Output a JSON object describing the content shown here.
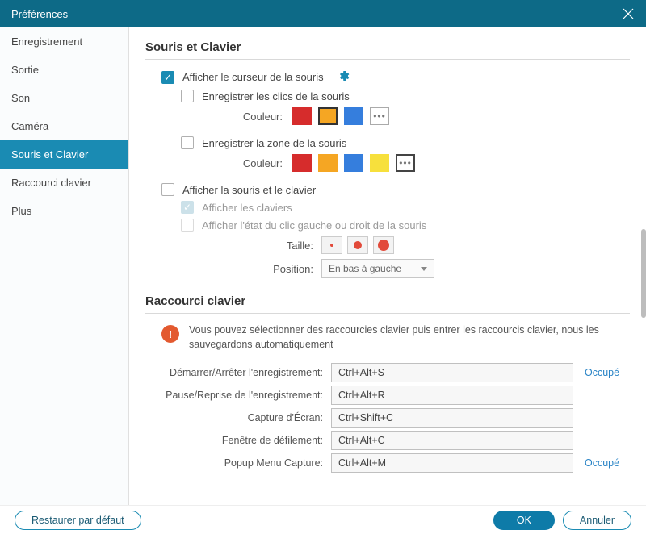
{
  "titlebar": {
    "title": "Préférences"
  },
  "sidebar": {
    "items": [
      {
        "label": "Enregistrement"
      },
      {
        "label": "Sortie"
      },
      {
        "label": "Son"
      },
      {
        "label": "Caméra"
      },
      {
        "label": "Souris et Clavier"
      },
      {
        "label": "Raccourci clavier"
      },
      {
        "label": "Plus"
      }
    ]
  },
  "mouse": {
    "section_title": "Souris et Clavier",
    "show_cursor": "Afficher le curseur de la souris",
    "record_clicks": "Enregistrer les clics de la souris",
    "color_label": "Couleur:",
    "record_area": "Enregistrer la zone de la souris",
    "show_mouse_kb": "Afficher la souris et le clavier",
    "show_keyboards": "Afficher les claviers",
    "show_click_state": "Afficher l'état du clic gauche ou droit de la souris",
    "size_label": "Taille:",
    "position_label": "Position:",
    "position_value": "En bas à gauche"
  },
  "hotkeys": {
    "section_title": "Raccourci clavier",
    "notice": "Vous pouvez sélectionner des raccourcies clavier puis entrer les raccourcis clavier, nous les sauvegardons automatiquement",
    "rows": [
      {
        "label": "Démarrer/Arrêter l'enregistrement:",
        "value": "Ctrl+Alt+S",
        "status": "Occupé"
      },
      {
        "label": "Pause/Reprise de l'enregistrement:",
        "value": "Ctrl+Alt+R",
        "status": ""
      },
      {
        "label": "Capture d'Écran:",
        "value": "Ctrl+Shift+C",
        "status": ""
      },
      {
        "label": "Fenêtre de défilement:",
        "value": "Ctrl+Alt+C",
        "status": ""
      },
      {
        "label": "Popup Menu Capture:",
        "value": "Ctrl+Alt+M",
        "status": "Occupé"
      }
    ]
  },
  "footer": {
    "restore": "Restaurer par défaut",
    "ok": "OK",
    "cancel": "Annuler"
  }
}
